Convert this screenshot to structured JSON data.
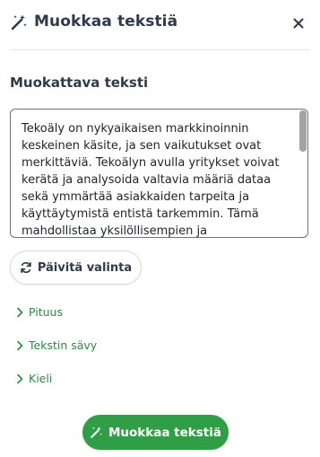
{
  "header": {
    "title": "Muokkaa tekstiä",
    "icon": "magic-wand-icon",
    "close_icon": "close-icon"
  },
  "editor": {
    "section_title": "Muokattava teksti",
    "text": "Tekoäly on nykyaikaisen markkinoinnin keskeinen käsite, ja sen vaikutukset ovat merkittäviä. Tekoälyn avulla yritykset voivat kerätä ja analysoida valtavia määriä dataa sekä ymmärtää asiakkaiden tarpeita ja käyttäytymistä entistä tarkemmin. Tämä mahdollistaa yksilöllisempien ja personoidumpien markkinointiviestien"
  },
  "refresh_button": {
    "label": "Päivitä valinta",
    "icon": "refresh-icon"
  },
  "options": [
    {
      "label": "Pituus",
      "icon": "chevron-right-icon"
    },
    {
      "label": "Tekstin sävy",
      "icon": "chevron-right-icon"
    },
    {
      "label": "Kieli",
      "icon": "chevron-right-icon"
    }
  ],
  "submit_button": {
    "label": "Muokkaa tekstiä",
    "icon": "magic-wand-icon"
  },
  "colors": {
    "accent_green": "#2f9e44",
    "text_dark": "#2f3a4a",
    "link_green": "#2b8a3e"
  }
}
